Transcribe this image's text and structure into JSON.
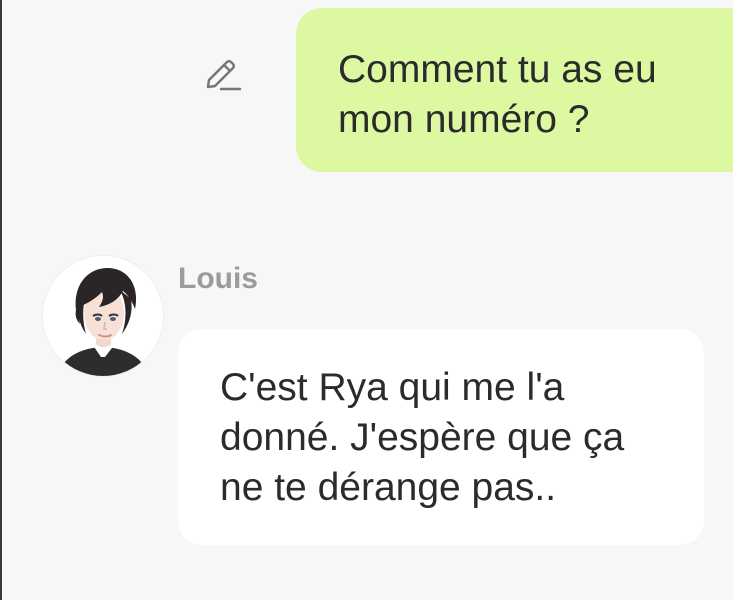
{
  "conversation": {
    "outgoing": {
      "text": "Comment tu as eu\nmon numéro ?"
    },
    "incoming": {
      "sender": "Louis",
      "text": "C'est Rya qui me l'a\ndonné. J'espère que ça\nne te dérange pas.."
    }
  },
  "icons": {
    "edit": "pencil-icon",
    "avatar": "character-portrait"
  },
  "colors": {
    "outgoing_bubble": "#dcf8a0",
    "incoming_bubble": "#ffffff",
    "background": "#f7f7f7",
    "sender_name": "#9b9b9b",
    "text": "#2b2b2b"
  }
}
